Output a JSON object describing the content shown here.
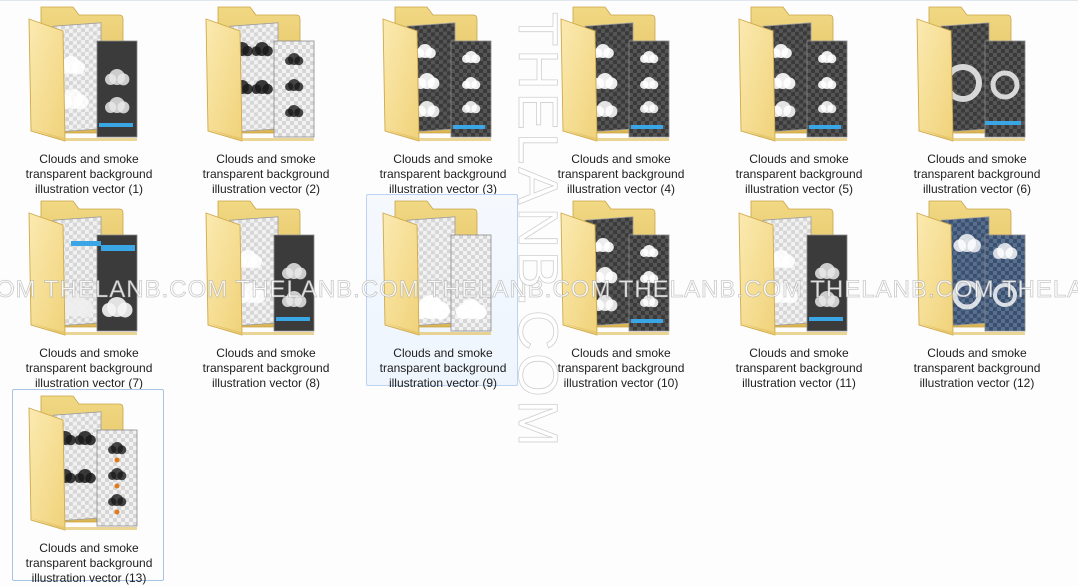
{
  "folder_label_prefix": "Clouds and smoke transparent background illustration vector",
  "items": [
    {
      "line1": "Clouds and smoke",
      "line2": "transparent background",
      "line3": "illustration vector (1)",
      "style": "dark-photo"
    },
    {
      "line1": "Clouds and smoke",
      "line2": "transparent background",
      "line3": "illustration vector (2)",
      "style": "light-smoke"
    },
    {
      "line1": "Clouds and smoke",
      "line2": "transparent background",
      "line3": "illustration vector (3)",
      "style": "dark-clouds"
    },
    {
      "line1": "Clouds and smoke",
      "line2": "transparent background",
      "line3": "illustration vector (4)",
      "style": "dark-clouds"
    },
    {
      "line1": "Clouds and smoke",
      "line2": "transparent background",
      "line3": "illustration vector (5)",
      "style": "dark-clouds"
    },
    {
      "line1": "Clouds and smoke",
      "line2": "transparent background",
      "line3": "illustration vector (6)",
      "style": "ring-smoke"
    },
    {
      "line1": "Clouds and smoke",
      "line2": "transparent background",
      "line3": "illustration vector (7)",
      "style": "blue-title"
    },
    {
      "line1": "Clouds and smoke",
      "line2": "transparent background",
      "line3": "illustration vector (8)",
      "style": "dark-photo"
    },
    {
      "line1": "Clouds and smoke",
      "line2": "transparent background",
      "line3": "illustration vector (9)",
      "style": "light-clouds"
    },
    {
      "line1": "Clouds and smoke",
      "line2": "transparent background",
      "line3": "illustration vector (10)",
      "style": "dark-clouds"
    },
    {
      "line1": "Clouds and smoke",
      "line2": "transparent background",
      "line3": "illustration vector (11)",
      "style": "dark-photo"
    },
    {
      "line1": "Clouds and smoke",
      "line2": "transparent background",
      "line3": "illustration vector (12)",
      "style": "blue-hearts"
    },
    {
      "line1": "Clouds and smoke",
      "line2": "transparent background",
      "line3": "illustration vector (13)",
      "style": "black-smoke"
    }
  ],
  "hovered_item": 8,
  "selected_item": 12,
  "watermark": {
    "vertical": "THELANB.COM",
    "horizontal": "OM THELANB.COM THELANB.COM THELANB.COM THELANB.COM THELANB.COM THELANB.COM THELANB.COM THE"
  },
  "colors": {
    "folder_back": "#e9cc6e",
    "folder_front": "#f7e29a",
    "selection_border": "#b9d3f1",
    "selection_fill": "#eef5fd",
    "text": "#1d1d1d"
  }
}
